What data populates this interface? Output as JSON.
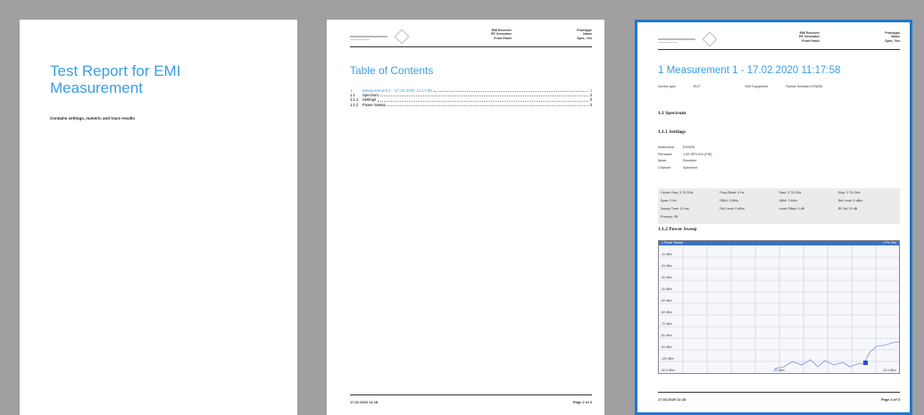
{
  "page1": {
    "title": "Test Report for EMI Measurement",
    "subtitle": "Contains settings, numeric and trace results"
  },
  "page2": {
    "header": {
      "col1": [
        "EMI Receiver",
        "RF Generator",
        "Front Panel"
      ],
      "col2": [
        "Prototype",
        "Name",
        "Spec_Yes"
      ]
    },
    "toc_title": "Table of Contents",
    "toc": [
      {
        "num": "1",
        "text": "Measurement 1 - 17.02.2020 11:17:58",
        "page": "3"
      },
      {
        "num": "1.1",
        "text": "Spectrum",
        "page": "3"
      },
      {
        "num": "1.1.1",
        "text": "Settings",
        "page": "3"
      },
      {
        "num": "1.1.2",
        "text": "Power Sweep",
        "page": "3"
      }
    ],
    "footer_left": "17.02.2020 11:18",
    "footer_right": "Page 2 of 3"
  },
  "page3": {
    "header": {
      "col1": [
        "EMI Receiver",
        "RF Generator",
        "Front Panel"
      ],
      "col2": [
        "Prototype",
        "Name",
        "Spec_Yes"
      ]
    },
    "title": "1   Measurement 1 - 17.02.2020 11:17:58",
    "info": [
      "Device type",
      "EUT",
      "EMI Equipment",
      "Rohde Schwarz ESW26"
    ],
    "sec_1_1": "1.1   Spectrum",
    "sec_1_1_1": "1.1.1  Settings",
    "settings": [
      {
        "k": "Instrument",
        "v": "ESW26"
      },
      {
        "k": "Firmware",
        "v": "1.00 SP3 b10 (FW)"
      },
      {
        "k": "Mode",
        "v": "Receiver"
      },
      {
        "k": "Channel",
        "v": "Spectrum"
      }
    ],
    "params": [
      "Center Freq: 2.75 GHz",
      "Freq Offset: 0 Hz",
      "Start: 2.75 GHz",
      "Stop: 2.75 GHz",
      "Span: 0 Hz",
      "RBW: 3 MHz",
      "VBW: 3 MHz",
      "Ref Level: 0 dBm",
      "Sweep Time: 10 ms",
      "Ref Level: 0 dBm",
      "Level Offset: 0 dB",
      "RF Att: 10 dB",
      "Preamp: Off",
      "",
      "",
      ""
    ],
    "sec_1_1_2": "1.1.2  Power Sweep",
    "chart_title": "1 Power Sweep",
    "chart_title_right": "1 Pk Clrw",
    "y_ticks": [
      "-10 dBm",
      "-20 dBm",
      "-30 dBm",
      "-40 dBm",
      "-50 dBm",
      "-60 dBm",
      "-70 dBm",
      "-80 dBm",
      "-90 dBm",
      "-100 dBm",
      "-110 dBm"
    ],
    "x_ticks": [
      "-30.0 dBm",
      "-20 dBm",
      "-10.0 dBm"
    ],
    "trace_color": "#7d90e8",
    "marker_color": "#2a4fd6",
    "footer_left": "17.02.2020 11:18",
    "footer_right": "Page 3 of 3"
  },
  "colors": {
    "accent": "#3a9fe0",
    "selection_border": "#1f78d1",
    "background": "#a0a0a0"
  }
}
